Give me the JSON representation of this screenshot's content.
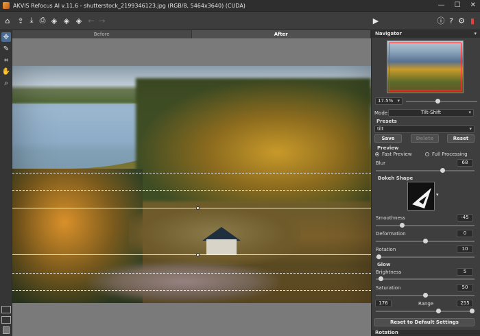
{
  "window": {
    "title": "AKVIS Refocus AI v.11.6 - shutterstock_2199346123.jpg (RGB/8, 5464x3640) (CUDA)",
    "minimize": "—",
    "maximize": "☐",
    "close": "✕"
  },
  "toolbar": {
    "left": [
      {
        "name": "open-home-icon",
        "glyph": "⌂"
      },
      {
        "name": "open-file-icon",
        "glyph": "⇪"
      },
      {
        "name": "save-file-icon",
        "glyph": "⤓"
      },
      {
        "name": "print-icon",
        "glyph": "⎙"
      },
      {
        "name": "plugin-1-icon",
        "glyph": "◈"
      },
      {
        "name": "plugin-2-icon",
        "glyph": "◈"
      },
      {
        "name": "plugin-3-icon",
        "glyph": "◈"
      },
      {
        "name": "undo-icon",
        "glyph": "←"
      },
      {
        "name": "redo-icon",
        "glyph": "→"
      }
    ],
    "run_glyph": "▶",
    "right": [
      {
        "name": "info-icon",
        "glyph": "ⓘ"
      },
      {
        "name": "help-icon",
        "glyph": "?"
      },
      {
        "name": "settings-icon",
        "glyph": "⚙"
      },
      {
        "name": "manual-icon",
        "glyph": "▮"
      }
    ]
  },
  "left_tools": [
    {
      "name": "refocus-tool-icon",
      "glyph": "✥",
      "active": true
    },
    {
      "name": "brush-tool-icon",
      "glyph": "✎",
      "active": false
    },
    {
      "name": "crop-tool-icon",
      "glyph": "⌗",
      "active": false
    },
    {
      "name": "hand-tool-icon",
      "glyph": "✋",
      "active": false
    },
    {
      "name": "zoom-tool-icon",
      "glyph": "⌕",
      "active": false
    }
  ],
  "tabs": {
    "before": "Before",
    "after": "After"
  },
  "navigator": {
    "title": "Navigator",
    "zoom": "17.5%",
    "zoom_arrow": "▾",
    "zoom_level": 0.45
  },
  "mode": {
    "label": "Mode:",
    "value": "Tilt-Shift",
    "arrow": "▾"
  },
  "presets": {
    "title": "Presets",
    "value": "tilt",
    "arrow": "▾",
    "save": "Save",
    "delete": "Delete",
    "reset": "Reset"
  },
  "preview": {
    "title": "Preview",
    "fast": "Fast Preview",
    "full": "Full Processing"
  },
  "blur": {
    "label": "Blur",
    "value": "68",
    "level": 0.68
  },
  "bokeh": {
    "title": "Bokeh Shape",
    "arrow": "▾",
    "smoothness": {
      "label": "Smoothness",
      "value": "-45",
      "level": 0.27
    },
    "deformation": {
      "label": "Deformation",
      "value": "0",
      "level": 0.5
    },
    "rotation": {
      "label": "Rotation",
      "value": "10",
      "level": 0.03
    }
  },
  "glow": {
    "title": "Glow",
    "brightness": {
      "label": "Brightness",
      "value": "5",
      "level": 0.05
    },
    "saturation": {
      "label": "Saturation",
      "value": "50",
      "level": 0.5
    },
    "range_min": "176",
    "range_label": "Range",
    "range_max": "255"
  },
  "reset_default": "Reset to Default Settings",
  "rotation_section": "Rotation"
}
